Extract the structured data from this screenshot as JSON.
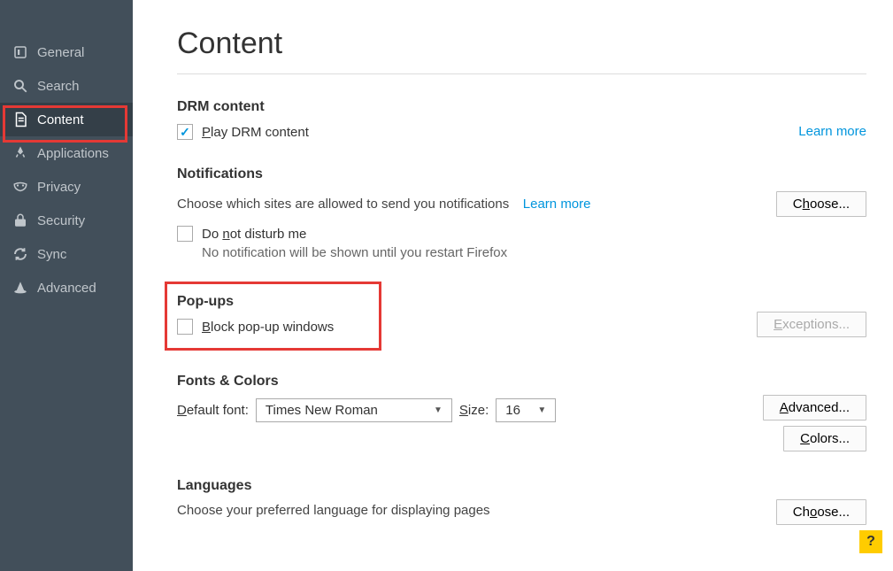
{
  "sidebar": {
    "items": [
      {
        "label": "General"
      },
      {
        "label": "Search"
      },
      {
        "label": "Content"
      },
      {
        "label": "Applications"
      },
      {
        "label": "Privacy"
      },
      {
        "label": "Security"
      },
      {
        "label": "Sync"
      },
      {
        "label": "Advanced"
      }
    ]
  },
  "page": {
    "title": "Content",
    "drm": {
      "heading": "DRM content",
      "play_pre": "P",
      "play_label": "lay DRM content",
      "learn_more": "Learn more"
    },
    "notifications": {
      "heading": "Notifications",
      "desc": "Choose which sites are allowed to send you notifications",
      "learn_more": "Learn more",
      "choose_pre": "C",
      "choose_u": "h",
      "choose_post": "oose...",
      "dnd_pre": "Do ",
      "dnd_u": "n",
      "dnd_post": "ot disturb me",
      "dnd_sub": "No notification will be shown until you restart Firefox"
    },
    "popups": {
      "heading": "Pop-ups",
      "block_u": "B",
      "block_post": "lock pop-up windows",
      "exceptions_u": "E",
      "exceptions_post": "xceptions..."
    },
    "fonts": {
      "heading": "Fonts & Colors",
      "default_u": "D",
      "default_post": "efault font:",
      "font_value": "Times New Roman",
      "size_u": "S",
      "size_post": "ize:",
      "size_value": "16",
      "advanced_u": "A",
      "advanced_post": "dvanced...",
      "colors_u": "C",
      "colors_post": "olors..."
    },
    "languages": {
      "heading": "Languages",
      "desc": "Choose your preferred language for displaying pages",
      "choose_pre": "Ch",
      "choose_u": "o",
      "choose_post": "ose..."
    },
    "help": "?"
  }
}
